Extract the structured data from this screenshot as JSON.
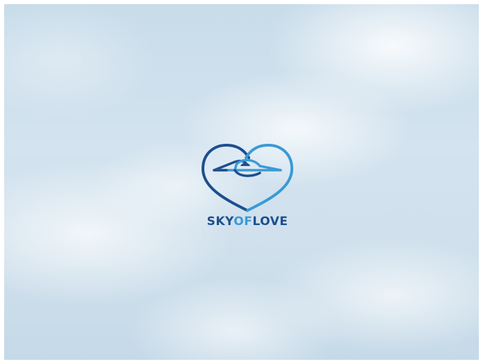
{
  "logo": {
    "wordmark_part1": "SKY",
    "wordmark_part2": "OF",
    "wordmark_part3": "LOVE",
    "colors": {
      "dark_blue": "#1d4f8f",
      "light_blue": "#3a9ad6"
    },
    "icon": "heart-with-airplane-icon"
  }
}
